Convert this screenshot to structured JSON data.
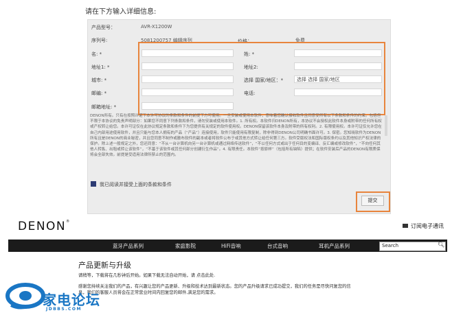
{
  "form": {
    "heading": "请在下方输入详细信息:",
    "model_label": "产品型号：",
    "model_value": "AVR-X1200W",
    "serial_label": "序列号:",
    "serial_value": "5081200757 编辑序列",
    "price_label": "价格：",
    "price_value": "免费",
    "name_label": "名: *",
    "surname_label": "姓: *",
    "address1_label": "地址1: *",
    "address2_label": "地址2:",
    "city_label": "城市: *",
    "country_label": "选择 国家/地区：*",
    "country_value": "选择 选择 国家/地区",
    "zip_label": "邮编: *",
    "phone_label": "电话:",
    "email_label": "邮箱地址: *",
    "terms_text": "DENON所有。只有在按照许诺下本许可协议的条款和条件的前提下方可使用。一旦安装或使用本软件，意味着您确认接收软件且同意受所有以下条款和条件的约束。包括但不限于本协议的免责声明部分：如果您不同意下列条款和条件，请勿安装或使用本软件。1. 所有权。本软件归DENON所有，本协议不会授权此软件本身或附带的任何所有权或产权转让给您。本许可证仅在此协议规定条款和条件下为您提供有关规定的软件使用权。DENON保留该软件本身及附带的所有权利。2. 有限使用权。本许可证仅允许您在自己内部用途使用软件，并且只能与您本人拥有的产品（“产品”）连接使用，软件只能使用有限复制，除非得到DENON公司明确书面许可。3. 保密。您知晓软件为DENON所有且是DENON的商业秘密，并且您同意不制作或散布软件的副本或者将软件公布于或其他方式转让给任何第三方。软件受版权法和国际版权条约以及其他知识产权法律的保护。除上述一般规定之外，您还同意：“不从一台计算机向另一台计算机或通过网络传送软件”，“不以任何方式或出于任何目的变编译、反汇编或修改软件”，“不向任何其他人转售、出租或转让该软件”，“不基于该软件或其任何部分创建衍生作品”。4. 有限责任。本软件“按原样”（包括所有缺陷）提供；在软件安装后产品的DENON有限质保将会全部失效。前提是受适用法律所禁止的范围内。",
    "agree_label": "我已阅读并接受上面的条款和条件",
    "submit_label": "提交"
  },
  "site": {
    "logo": "DENON",
    "logo_mark": "®",
    "subscribe": "订阅电子通讯",
    "nav": [
      "蓝牙产品系列",
      "家庭影院",
      "HiFi音响",
      "台式音响",
      "耳机产品系列"
    ],
    "search_placeholder": "Search",
    "page_title": "产品更新与升级",
    "msg_line1": "请稍等，下载将在几秒钟后开始。如果下载无法自动开始，请 点击此处.",
    "msg_line2": "感谢您持续关注我们的产品，有兴趣让您的产品更新、升级和技术达到最新状态。您的产品升级请求已成功提交，我们的任务是尽快问复您的信",
    "msg_line3": "息，我们的客服人员将会在正常营业时间内回复您的邮件,满足您的需求。"
  },
  "watermark": {
    "title": "家电论坛",
    "url": "JDBBS.COM"
  },
  "colors": {
    "accent_orange": "#e8843c",
    "nav_bg": "#1b1b1b",
    "checkbox": "#2c3b73",
    "watermark_blue": "#1a76c4"
  }
}
